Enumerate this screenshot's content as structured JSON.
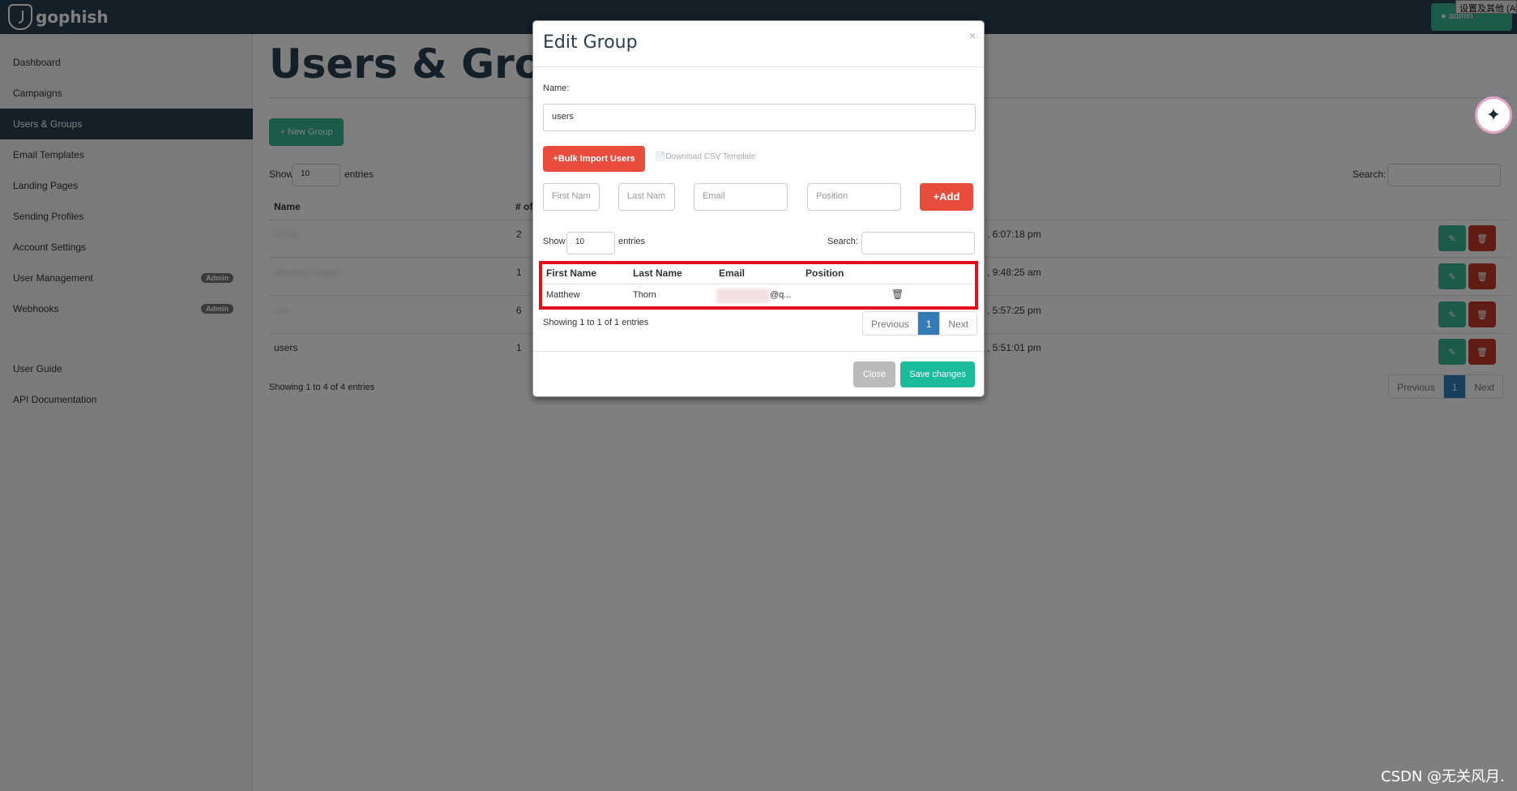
{
  "brand": {
    "name": "gophish"
  },
  "navbar": {
    "user_button": "admin",
    "tooltip": "设置及其他 (Alt+F)"
  },
  "sidebar": {
    "items": [
      {
        "label": "Dashboard"
      },
      {
        "label": "Campaigns"
      },
      {
        "label": "Users & Groups",
        "active": true
      },
      {
        "label": "Email Templates"
      },
      {
        "label": "Landing Pages"
      },
      {
        "label": "Sending Profiles"
      },
      {
        "label": "Account Settings"
      },
      {
        "label": "User Management",
        "badge": "Admin"
      },
      {
        "label": "Webhooks",
        "badge": "Admin"
      }
    ],
    "footer_items": [
      {
        "label": "User Guide"
      },
      {
        "label": "API Documentation"
      }
    ]
  },
  "main": {
    "title": "Users & Groups",
    "new_group_label": "New Group",
    "show_label": "Show",
    "entries_label": "entries",
    "page_length": "10",
    "search_label": "Search:",
    "columns": {
      "name": "Name",
      "count": "# of"
    },
    "rows": [
      {
        "name": "group",
        "count": "2",
        "modified": ", 6:07:18 pm",
        "blurred": true
      },
      {
        "name": "phishing targets",
        "count": "1",
        "modified": ", 9:48:25 am",
        "blurred": true
      },
      {
        "name": "test",
        "count": "6",
        "modified": ", 5:57:25 pm",
        "blurred": true
      },
      {
        "name": "users",
        "count": "1",
        "modified": ", 5:51:01 pm",
        "blurred": false
      }
    ],
    "info": "Showing 1 to 4 of 4 entries",
    "pager": {
      "previous": "Previous",
      "current": "1",
      "next": "Next"
    }
  },
  "modal": {
    "title": "Edit Group",
    "close_x": "×",
    "name_label": "Name:",
    "name_value": "users",
    "bulk_import_label": "Bulk Import Users",
    "csv_template_label": "Download CSV Template",
    "placeholders": {
      "first": "First Nam",
      "last": "Last Nam",
      "email": "Email",
      "position": "Position"
    },
    "add_label": "Add",
    "show_label": "Show",
    "entries_label": "entries",
    "page_length": "10",
    "search_label": "Search:",
    "columns": {
      "first": "First Name",
      "last": "Last Name",
      "email": "Email",
      "position": "Position"
    },
    "row": {
      "first": "Matthew",
      "last": "Thorn",
      "email": "@q..."
    },
    "info": "Showing 1 to 1 of 1 entries",
    "pager": {
      "previous": "Previous",
      "current": "1",
      "next": "Next"
    },
    "close_label": "Close",
    "save_label": "Save changes"
  },
  "watermark": "CSDN @无关风月."
}
